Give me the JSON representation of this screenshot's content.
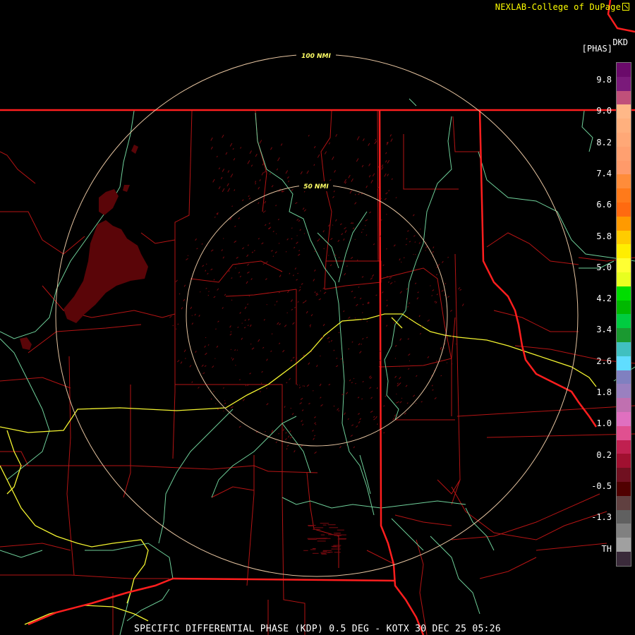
{
  "credit": "NEXLAB-College of DuPage",
  "site_label": "DKD",
  "unit_label": "[PHAS]",
  "caption": "SPECIFIC DIFFERENTIAL PHASE (KDP) 0.5 DEG - KOTX 30 DEC 25 05:26",
  "range_rings": [
    {
      "label": "100 NMI"
    },
    {
      "label": "50 NMI"
    }
  ],
  "colorbar": {
    "ticks": [
      "9.8",
      "9.0",
      "8.2",
      "7.4",
      "6.6",
      "5.8",
      "5.0",
      "4.2",
      "3.4",
      "2.6",
      "1.8",
      "1.0",
      "0.2",
      "-0.5",
      "-1.3",
      "TH"
    ],
    "colors": [
      "#6a0a6a",
      "#7a1a7a",
      "#c0507a",
      "#ffb888",
      "#ffb07e",
      "#ffa877",
      "#ffa070",
      "#ff9a6a",
      "#ff8c3a",
      "#ff7a1a",
      "#ff6a10",
      "#ff9a00",
      "#ffcc00",
      "#ffee00",
      "#ffff33",
      "#e8ff20",
      "#00dd00",
      "#00b800",
      "#00cc40",
      "#1a9930",
      "#40c0c0",
      "#60ddff",
      "#8080c0",
      "#9a80c0",
      "#c070b0",
      "#e070c0",
      "#e05090",
      "#c02050",
      "#a01030",
      "#701020",
      "#500000",
      "#604040",
      "#606060",
      "#808080",
      "#a0a0a0",
      "#3a2a3a"
    ]
  },
  "colors": {
    "state_lines": "#ff1a1a",
    "county_lines": "#c01818",
    "rivers": "#7fd8a0",
    "highways": "#ffff44",
    "rings": "#e8c8a8",
    "echo": "#5a0508"
  }
}
